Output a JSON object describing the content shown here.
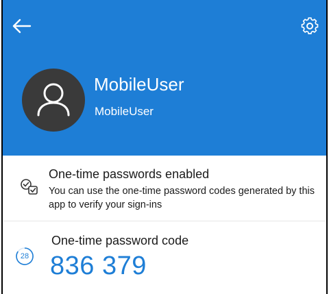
{
  "header": {
    "back_icon": "arrow-left-icon",
    "settings_icon": "gear-icon",
    "background": "#1e7ed6"
  },
  "account": {
    "name": "MobileUser",
    "username": "MobileUser",
    "avatar_icon": "person-icon"
  },
  "otp_status": {
    "icon": "checklist-icon",
    "title": "One-time passwords enabled",
    "description": "You can use the one-time password codes generated by this app to verify your sign-ins"
  },
  "otp_code": {
    "label": "One-time password code",
    "code": "836 379",
    "seconds_remaining": "28",
    "accent": "#1e7ed6"
  }
}
